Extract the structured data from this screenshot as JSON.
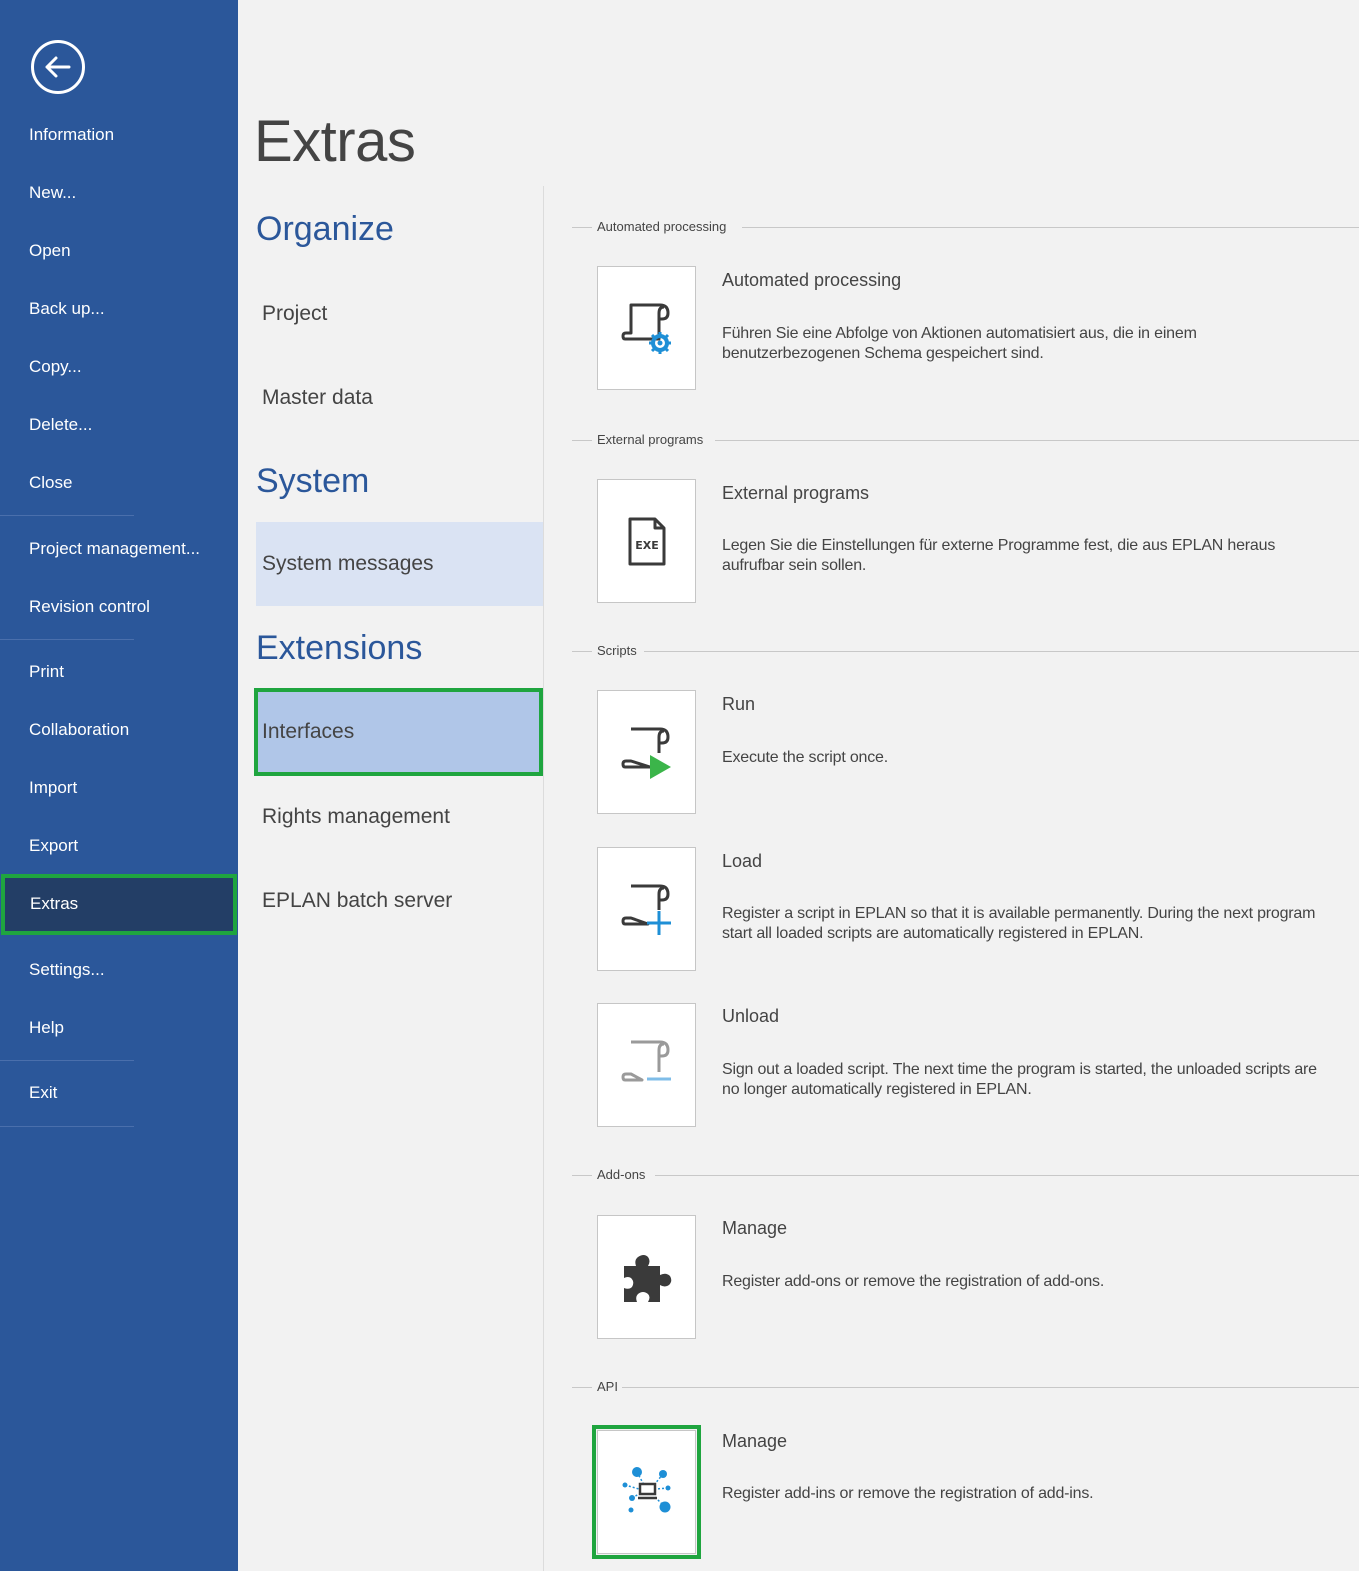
{
  "sidebar": {
    "back_icon": "back-arrow-circle-icon",
    "items": [
      {
        "label": "Information"
      },
      {
        "label": "New..."
      },
      {
        "label": "Open"
      },
      {
        "label": "Back up..."
      },
      {
        "label": "Copy..."
      },
      {
        "label": "Delete..."
      },
      {
        "label": "Close"
      },
      {
        "label": "Project management..."
      },
      {
        "label": "Revision control"
      },
      {
        "label": "Print"
      },
      {
        "label": "Collaboration"
      },
      {
        "label": "Import"
      },
      {
        "label": "Export"
      },
      {
        "label": "Extras"
      },
      {
        "label": "Settings..."
      },
      {
        "label": "Help"
      },
      {
        "label": "Exit"
      }
    ],
    "active": "Extras"
  },
  "page": {
    "title": "Extras"
  },
  "middle": {
    "organize": {
      "heading": "Organize",
      "items": [
        "Project",
        "Master data"
      ]
    },
    "system": {
      "heading": "System",
      "items": [
        "System messages"
      ]
    },
    "extensions": {
      "heading": "Extensions",
      "items": [
        "Interfaces",
        "Rights management",
        "EPLAN batch server"
      ]
    },
    "selected": "Interfaces"
  },
  "content": {
    "sections": [
      {
        "label": "Automated processing",
        "tiles": [
          {
            "title": "Automated processing",
            "desc": "Führen Sie eine Abfolge von Aktionen automatisiert aus, die in einem benutzerbezogenen Schema gespeichert sind.",
            "icon": "script-gear-icon"
          }
        ]
      },
      {
        "label": "External programs",
        "tiles": [
          {
            "title": "External programs",
            "desc": "Legen Sie die Einstellungen für externe Programme fest, die aus EPLAN heraus aufrufbar sein sollen.",
            "icon": "exe-file-icon",
            "icon_text": "EXE"
          }
        ]
      },
      {
        "label": "Scripts",
        "tiles": [
          {
            "title": "Run",
            "desc": "Execute the script once.",
            "icon": "script-run-icon"
          },
          {
            "title": "Load",
            "desc": "Register a script in EPLAN so that it is available permanently. During the next program start all loaded scripts are automatically registered in EPLAN.",
            "icon": "script-load-icon"
          },
          {
            "title": "Unload",
            "desc": "Sign out a loaded script. The next time the program is started, the unloaded scripts are no longer automatically registered in EPLAN.",
            "icon": "script-unload-icon"
          }
        ]
      },
      {
        "label": "Add-ons",
        "tiles": [
          {
            "title": "Manage",
            "desc": "Register add-ons or remove the registration of add-ons.",
            "icon": "puzzle-piece-icon"
          }
        ]
      },
      {
        "label": "API",
        "tiles": [
          {
            "title": "Manage",
            "desc": "Register add-ins or remove the registration of add-ins.",
            "icon": "api-network-icon"
          }
        ]
      }
    ]
  },
  "colors": {
    "sidebar": "#2b579a",
    "sidebar_active": "#233e66",
    "highlight_frame": "#1fa53f",
    "heading_blue": "#2b579a",
    "selected_item": "#b0c6e8",
    "soft_item": "#dae3f3",
    "icon_accent_blue": "#1e8fd6",
    "icon_accent_green": "#3bb54a"
  }
}
